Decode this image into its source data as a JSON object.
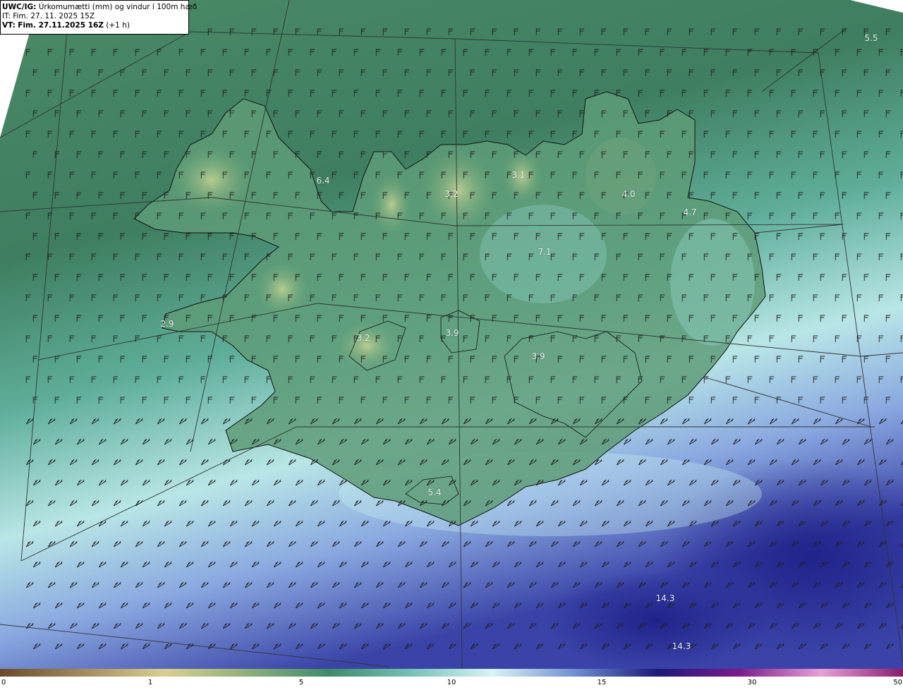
{
  "header": {
    "model": "UWC/IG:",
    "title": "Úrkomumætti (mm) og vindur í 100m hæð",
    "init_time": "IT: Fim. 27. 11. 2025 15Z",
    "valid_prefix": "VT:",
    "valid_time": "Fim. 27.11.2025 16Z",
    "valid_offset": "(+1 h)"
  },
  "precip_labels": [
    "5.5",
    "6.4",
    "3.1",
    "3.2",
    "4.0",
    "4.7",
    "7.1",
    "2.9",
    "3.2",
    "3.9",
    "3.9",
    "5.4",
    "14.3",
    "14.3"
  ],
  "colorbar": {
    "ticks": [
      "0",
      "1",
      "5",
      "10",
      "15",
      "30",
      "50"
    ],
    "colors": [
      "#6b4a2a",
      "#a38a5c",
      "#d9cf8f",
      "#8fb07a",
      "#3f8a6a",
      "#77c0b4",
      "#d8f4f4",
      "#6f8fd0",
      "#1c1a7a",
      "#7a1a8a",
      "#e8a0d8",
      "#8a1a6a"
    ]
  },
  "palette": {
    "coastline": "#111111",
    "grid": "#333333",
    "barb": "#222222"
  }
}
